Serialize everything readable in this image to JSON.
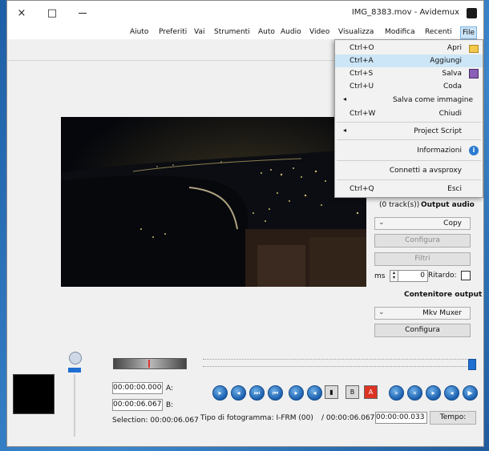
{
  "window": {
    "title": "IMG_8383.mov - Avidemux",
    "close": "×",
    "maximize": "□"
  },
  "menubar": [
    "File",
    "Recenti",
    "Modifica",
    "Visualizza",
    "Video",
    "Audio",
    "Auto",
    "Strumenti",
    "Vai",
    "Preferiti",
    "Aiuto"
  ],
  "file_menu": {
    "items": [
      {
        "label": "Apri",
        "shortcut": "Ctrl+O",
        "icon": "open-folder-icon"
      },
      {
        "label": "Aggiungi",
        "shortcut": "Ctrl+A",
        "highlighted": true
      },
      {
        "label": "Salva",
        "shortcut": "Ctrl+S",
        "icon": "save-icon"
      },
      {
        "label": "Coda",
        "shortcut": "Ctrl+U"
      },
      {
        "label": "Salva come immagine",
        "submenu": true
      },
      {
        "label": "Chiudi",
        "shortcut": "Ctrl+W"
      },
      {
        "label": "Project Script",
        "submenu": true
      },
      {
        "label": "Informazioni",
        "icon": "info-icon"
      },
      {
        "label": "Connetti a avsproxy"
      },
      {
        "label": "Esci",
        "shortcut": "Ctrl+Q"
      }
    ]
  },
  "audio_output": {
    "title": "Output audio",
    "tracks": "(0 track(s))",
    "codec": "Copy",
    "configure": "Configura",
    "filters": "Filtri",
    "delay_label": "Ritardo:",
    "delay_value": "0",
    "delay_unit": "ms"
  },
  "container_output": {
    "title": "Contenitore output",
    "muxer": "Mkv Muxer",
    "configure": "Configura"
  },
  "selection": {
    "a_label": "A:",
    "a_value": "00:00:00.000",
    "b_label": "B:",
    "b_value": "00:00:06.067",
    "selection_text": "Selection: 00:00:06.067"
  },
  "status": {
    "time_label": "Tempo:",
    "time_value": "00:00:00.033",
    "duration": "/ 00:00:06.067",
    "frame_type": "Tipo di fotogramma: I-FRM (00)"
  },
  "colors": {
    "accent": "#1a5fae",
    "highlight": "#cde6f7",
    "desktop": "#2d6fb3"
  }
}
